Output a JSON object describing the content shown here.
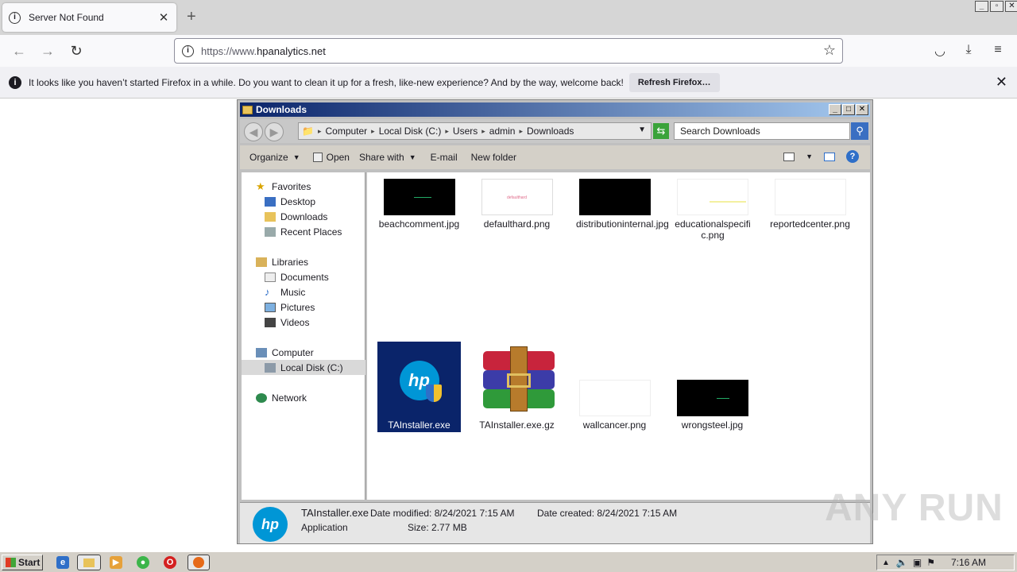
{
  "browser": {
    "tab_title": "Server Not Found",
    "url_prefix": "https://www.",
    "url_domain": "hpanalytics.net"
  },
  "notification": {
    "text": "It looks like you haven’t started Firefox in a while. Do you want to clean it up for a fresh, like-new experience? And by the way, welcome back!",
    "button": "Refresh Firefox…"
  },
  "explorer": {
    "title": "Downloads",
    "breadcrumb": [
      "Computer",
      "Local Disk (C:)",
      "Users",
      "admin",
      "Downloads"
    ],
    "search_placeholder": "Search Downloads",
    "toolbar": {
      "organize": "Organize",
      "open": "Open",
      "share_with": "Share with",
      "email": "E-mail",
      "new_folder": "New folder"
    },
    "nav": {
      "favorites": "Favorites",
      "desktop": "Desktop",
      "downloads": "Downloads",
      "recent_places": "Recent Places",
      "libraries": "Libraries",
      "documents": "Documents",
      "music": "Music",
      "pictures": "Pictures",
      "videos": "Videos",
      "computer": "Computer",
      "local_disk": "Local Disk (C:)",
      "network": "Network"
    },
    "files": [
      {
        "name": "beachcomment.jpg",
        "thumb": "dark"
      },
      {
        "name": "defaulthard.png",
        "thumb": "light-pink-text",
        "thumb_text": "defaulthard"
      },
      {
        "name": "distributioninternal.jpg",
        "thumb": "dark"
      },
      {
        "name": "educationalspecific.png",
        "thumb": "light-yellow-line"
      },
      {
        "name": "reportedcenter.png",
        "thumb": "white"
      },
      {
        "name": "TAInstaller.exe",
        "thumb": "hp-logo",
        "selected": true
      },
      {
        "name": "TAInstaller.exe.gz",
        "thumb": "winrar"
      },
      {
        "name": "wallcancer.png",
        "thumb": "white"
      },
      {
        "name": "wrongsteel.jpg",
        "thumb": "dark"
      }
    ],
    "status": {
      "filename": "TAInstaller.exe",
      "type": "Application",
      "date_modified_label": "Date modified:",
      "date_modified": "8/24/2021 7:15 AM",
      "date_created_label": "Date created:",
      "date_created": "8/24/2021 7:15 AM",
      "size_label": "Size:",
      "size": "2.77 MB"
    }
  },
  "taskbar": {
    "start": "Start",
    "clock": "7:16 AM"
  },
  "watermark": "ANY RUN",
  "colors": {
    "selection": "#0a246a",
    "hp_blue": "#0096d6",
    "titlebar_start": "#0a246a",
    "titlebar_end": "#a6caf0"
  }
}
